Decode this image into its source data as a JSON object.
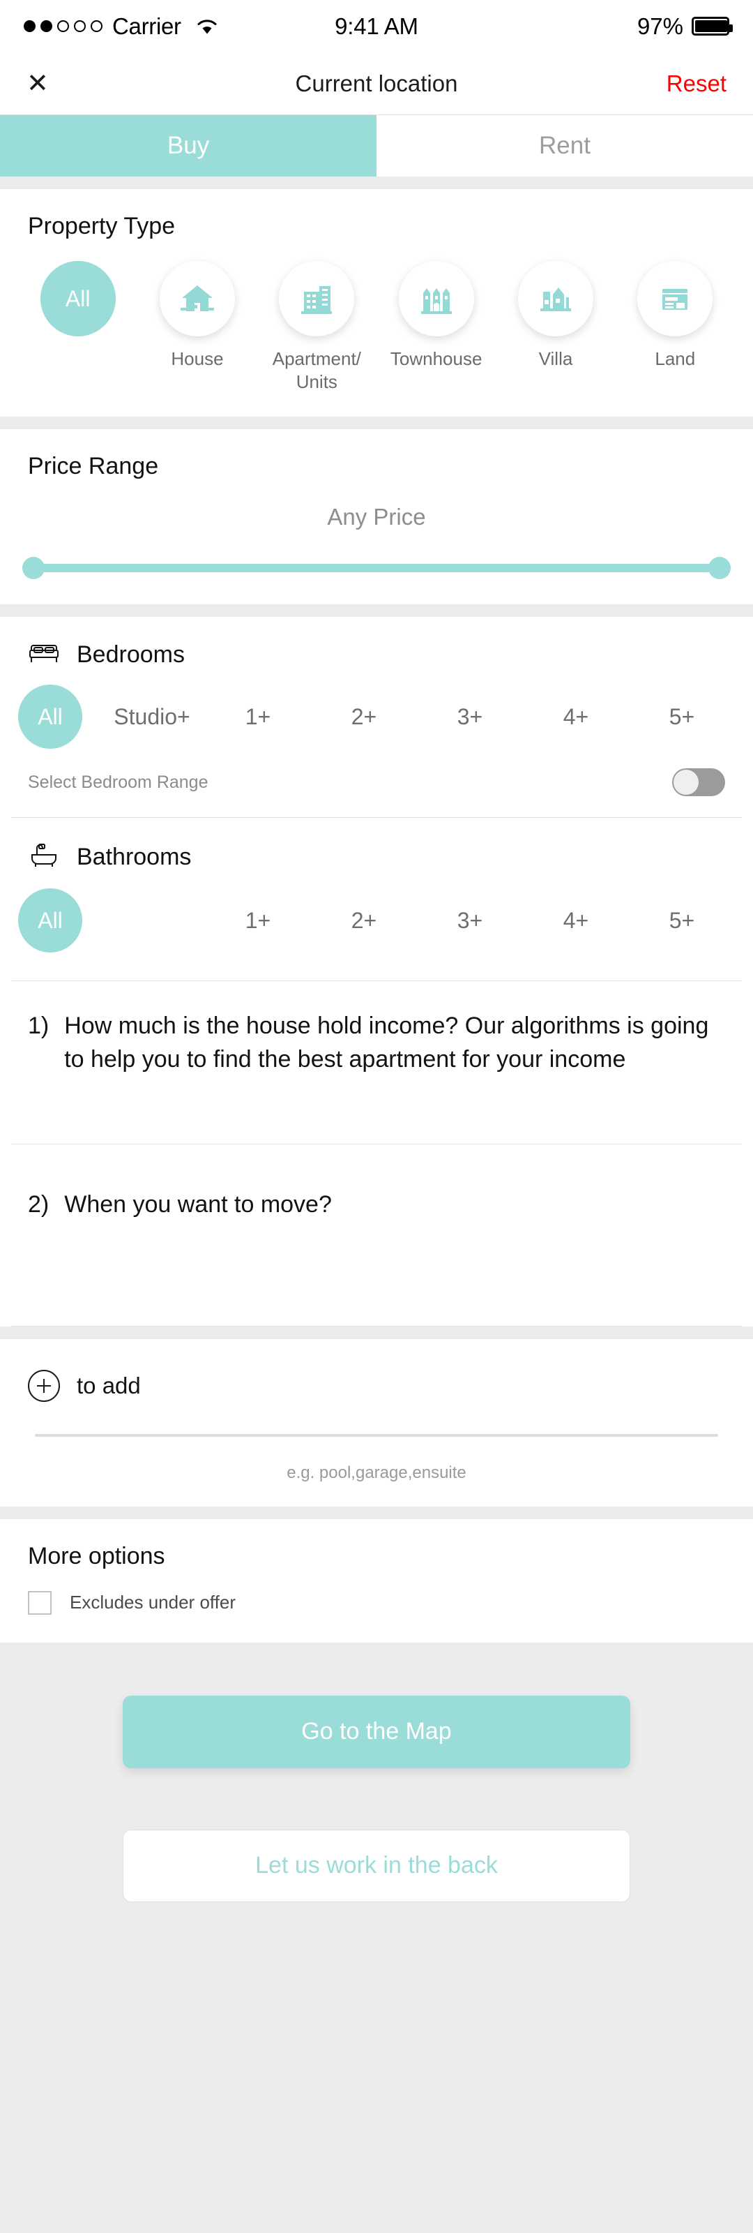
{
  "statusbar": {
    "carrier": "Carrier",
    "signal_dots_filled": 2,
    "signal_dots_total": 5,
    "wifi_icon": "wifi-icon",
    "time": "9:41 AM",
    "battery_percent": "97%",
    "battery_icon": "battery-icon"
  },
  "navbar": {
    "close_icon": "close-icon",
    "close_glyph": "✕",
    "title": "Current location",
    "reset_label": "Reset",
    "reset_color": "#ff0000"
  },
  "segment": {
    "tabs": [
      {
        "label": "Buy",
        "selected": true
      },
      {
        "label": "Rent",
        "selected": false
      }
    ]
  },
  "property_type": {
    "title": "Property Type",
    "items": [
      {
        "label": "All",
        "icon": "all-text",
        "selected": true
      },
      {
        "label": "House",
        "icon": "house-icon",
        "selected": false
      },
      {
        "label": "Apartment/\nUnits",
        "icon": "apartment-icon",
        "selected": false
      },
      {
        "label": "Townhouse",
        "icon": "townhouse-icon",
        "selected": false
      },
      {
        "label": "Villa",
        "icon": "villa-icon",
        "selected": false
      },
      {
        "label": "Land",
        "icon": "land-icon",
        "selected": false
      }
    ]
  },
  "price_range": {
    "title": "Price Range",
    "value_label": "Any Price",
    "slider": {
      "min_handle": 0,
      "max_handle": 100,
      "track_color": "#9adcd8"
    }
  },
  "bedrooms": {
    "icon": "bed-icon",
    "title": "Bedrooms",
    "options": [
      {
        "label": "All",
        "selected": true
      },
      {
        "label": "Studio+",
        "selected": false
      },
      {
        "label": "1+",
        "selected": false
      },
      {
        "label": "2+",
        "selected": false
      },
      {
        "label": "3+",
        "selected": false
      },
      {
        "label": "4+",
        "selected": false
      },
      {
        "label": "5+",
        "selected": false
      }
    ],
    "range_toggle": {
      "label": "Select Bedroom Range",
      "on": false
    }
  },
  "bathrooms": {
    "icon": "bathtub-icon",
    "title": "Bathrooms",
    "options": [
      {
        "label": "All",
        "selected": true
      },
      {
        "label": "1+",
        "selected": false
      },
      {
        "label": "2+",
        "selected": false
      },
      {
        "label": "3+",
        "selected": false
      },
      {
        "label": "4+",
        "selected": false
      },
      {
        "label": "5+",
        "selected": false
      }
    ]
  },
  "questions": [
    {
      "number": "1)",
      "text": "How much is the house hold income? Our algorithms is going to help you to find the best apartment for your income",
      "answer_value": ""
    },
    {
      "number": "2)",
      "text": "When you want to move?",
      "answer_value": ""
    }
  ],
  "to_add": {
    "icon": "plus-circle-icon",
    "label": "to add",
    "input_value": "",
    "hint": "e.g. pool,garage,ensuite"
  },
  "more_options": {
    "title": "More options",
    "checkbox": {
      "label": "Excludes under offer",
      "checked": false
    }
  },
  "footer": {
    "primary_label": "Go to the Map",
    "secondary_label": "Let us work in the back"
  },
  "theme": {
    "accent": "#9adcd8",
    "page_bg": "#ececec",
    "card_bg": "#ffffff",
    "muted_text": "#8d8d8d"
  }
}
